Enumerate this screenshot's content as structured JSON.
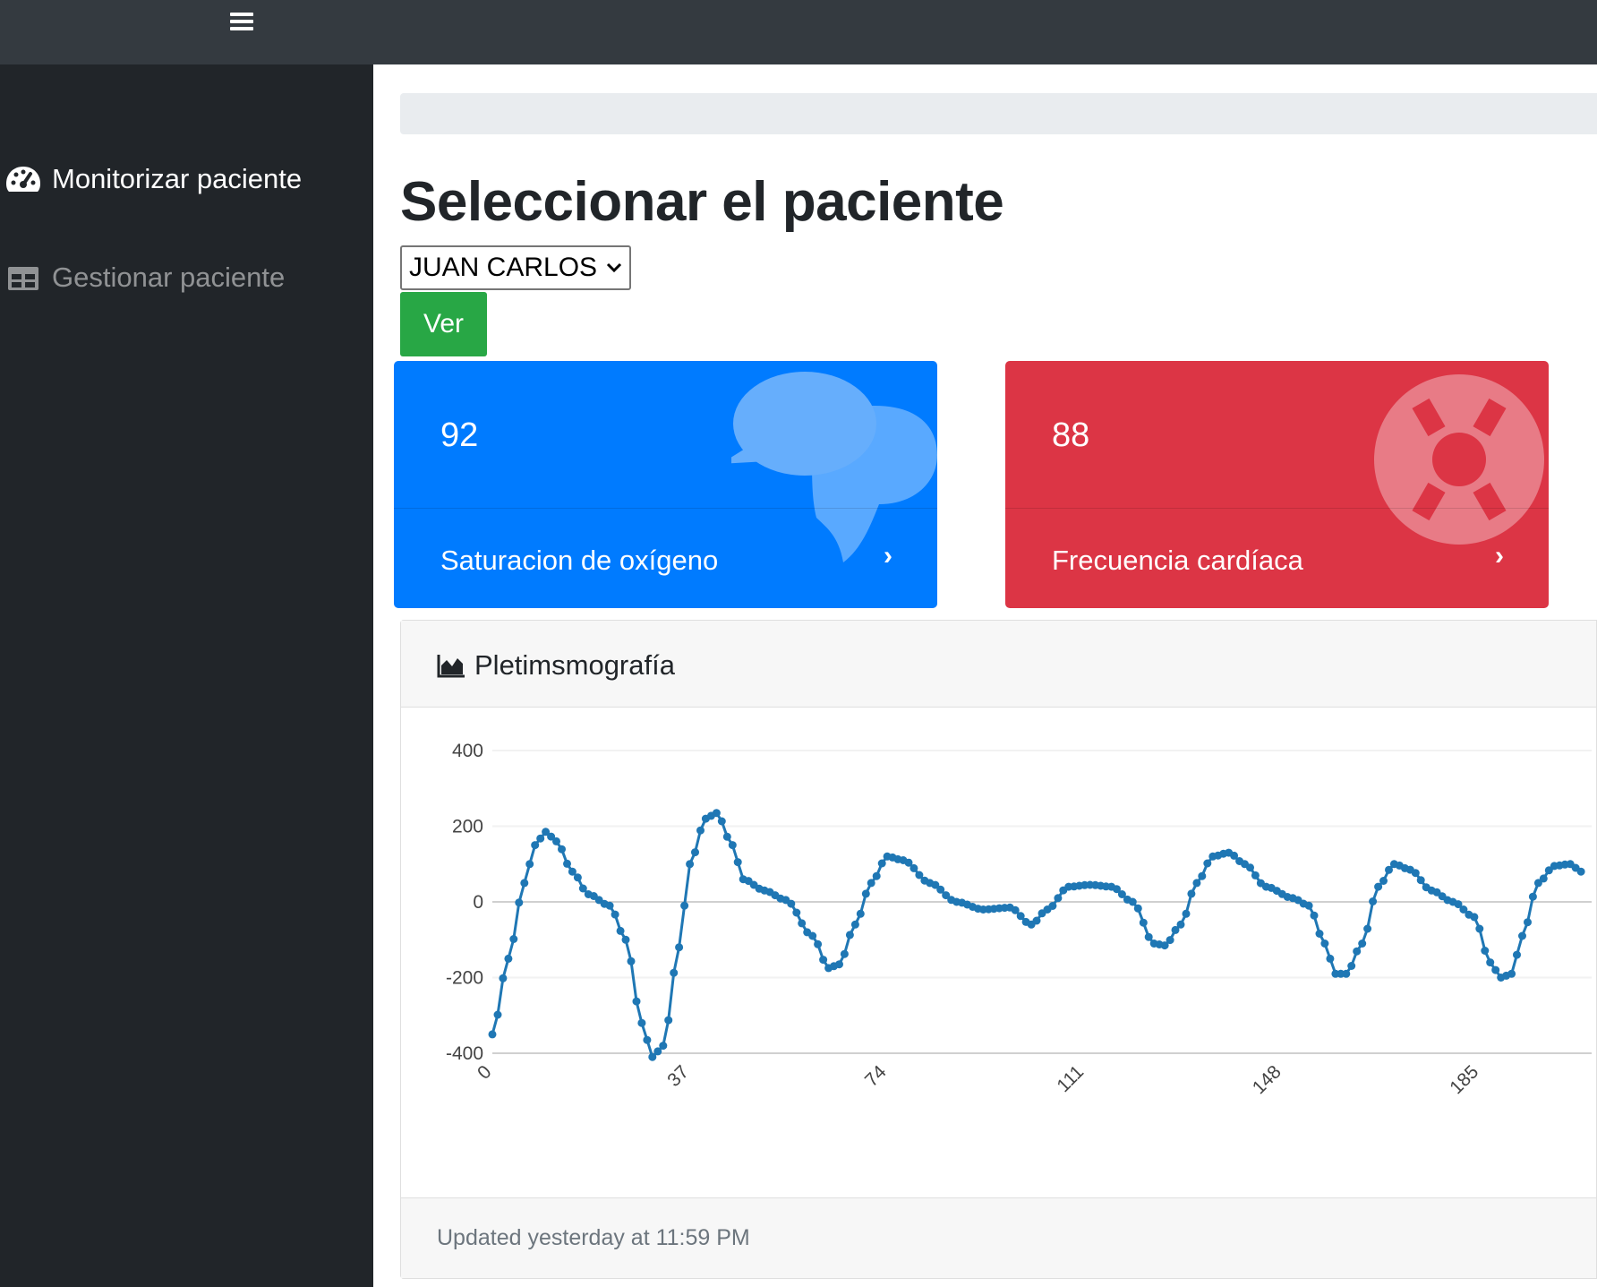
{
  "topbar": {
    "menu_icon": "hamburger-icon"
  },
  "sidebar": {
    "items": [
      {
        "label": "Monitorizar paciente",
        "icon": "tachometer-icon",
        "active": true
      },
      {
        "label": "Gestionar paciente",
        "icon": "table-icon",
        "active": false
      }
    ]
  },
  "main": {
    "title": "Seleccionar el paciente",
    "patient_select": {
      "value": "JUAN CARLOS"
    },
    "ver_label": "Ver",
    "cards": [
      {
        "value": "92",
        "label": "Saturacion de oxígeno",
        "color": "#007bff",
        "icon": "comments-icon"
      },
      {
        "value": "88",
        "label": "Frecuencia cardíaca",
        "color": "#dc3545",
        "icon": "life-ring-icon"
      }
    ],
    "chart_card": {
      "title": "Pletimsmografía",
      "icon": "area-chart-icon",
      "updated": "Updated yesterday at 11:59 PM"
    }
  },
  "chart_data": {
    "type": "line",
    "title": "",
    "xlabel": "",
    "ylabel": "",
    "ylim": [
      -400,
      400
    ],
    "y_ticks": [
      "400",
      "200",
      "0",
      "-200",
      "-400"
    ],
    "x_ticks": [
      "0",
      "37",
      "74",
      "111",
      "148",
      "185"
    ],
    "grid": true,
    "series": [
      {
        "color": "#1f77b4",
        "markers": true,
        "keypoints": [
          [
            0,
            -350
          ],
          [
            3,
            -150
          ],
          [
            6,
            50
          ],
          [
            8,
            150
          ],
          [
            10,
            185
          ],
          [
            12,
            160
          ],
          [
            15,
            80
          ],
          [
            18,
            20
          ],
          [
            22,
            -10
          ],
          [
            25,
            -100
          ],
          [
            28,
            -320
          ],
          [
            30,
            -410
          ],
          [
            32,
            -380
          ],
          [
            35,
            -120
          ],
          [
            37,
            100
          ],
          [
            40,
            220
          ],
          [
            42,
            235
          ],
          [
            45,
            150
          ],
          [
            47,
            60
          ],
          [
            51,
            30
          ],
          [
            55,
            5
          ],
          [
            60,
            -90
          ],
          [
            63,
            -175
          ],
          [
            65,
            -165
          ],
          [
            68,
            -60
          ],
          [
            71,
            50
          ],
          [
            74,
            120
          ],
          [
            77,
            110
          ],
          [
            82,
            50
          ],
          [
            87,
            0
          ],
          [
            92,
            -20
          ],
          [
            97,
            -15
          ],
          [
            101,
            -60
          ],
          [
            104,
            -20
          ],
          [
            108,
            40
          ],
          [
            112,
            45
          ],
          [
            116,
            40
          ],
          [
            120,
            0
          ],
          [
            124,
            -110
          ],
          [
            126,
            -115
          ],
          [
            129,
            -60
          ],
          [
            132,
            50
          ],
          [
            135,
            120
          ],
          [
            138,
            130
          ],
          [
            141,
            100
          ],
          [
            145,
            40
          ],
          [
            150,
            10
          ],
          [
            153,
            -10
          ],
          [
            156,
            -110
          ],
          [
            158,
            -190
          ],
          [
            160,
            -190
          ],
          [
            163,
            -110
          ],
          [
            166,
            40
          ],
          [
            169,
            100
          ],
          [
            172,
            85
          ],
          [
            176,
            30
          ],
          [
            180,
            0
          ],
          [
            184,
            -40
          ],
          [
            187,
            -160
          ],
          [
            189,
            -200
          ],
          [
            191,
            -190
          ],
          [
            193,
            -90
          ],
          [
            196,
            50
          ],
          [
            199,
            95
          ],
          [
            202,
            100
          ],
          [
            204,
            80
          ]
        ]
      }
    ]
  }
}
